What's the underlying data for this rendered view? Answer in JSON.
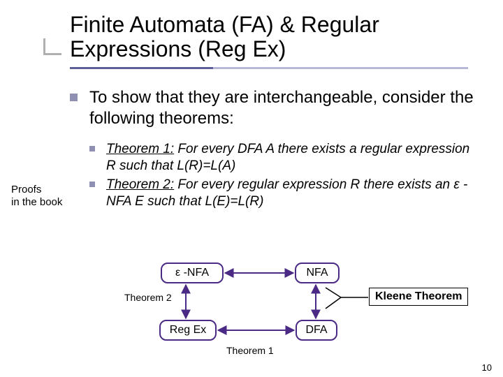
{
  "title": "Finite Automata (FA) & Regular Expressions (Reg Ex)",
  "main_bullet": "To show that they are interchangeable, consider the following theorems:",
  "side_label": "Proofs\nin the book",
  "theorems": [
    {
      "label": "Theorem 1:",
      "body": " For every DFA A there exists a regular expression R such that L(R)=L(A)"
    },
    {
      "label": "Theorem 2:",
      "body": " For every regular expression R there exists an ε -NFA E such that L(E)=L(R)"
    }
  ],
  "diagram": {
    "boxes": {
      "enfa": "ε -NFA",
      "nfa": "NFA",
      "regex": "Reg Ex",
      "dfa": "DFA"
    },
    "labels": {
      "t2": "Theorem 2",
      "t1": "Theorem 1",
      "kleene": "Kleene Theorem"
    }
  },
  "page_number": "10"
}
